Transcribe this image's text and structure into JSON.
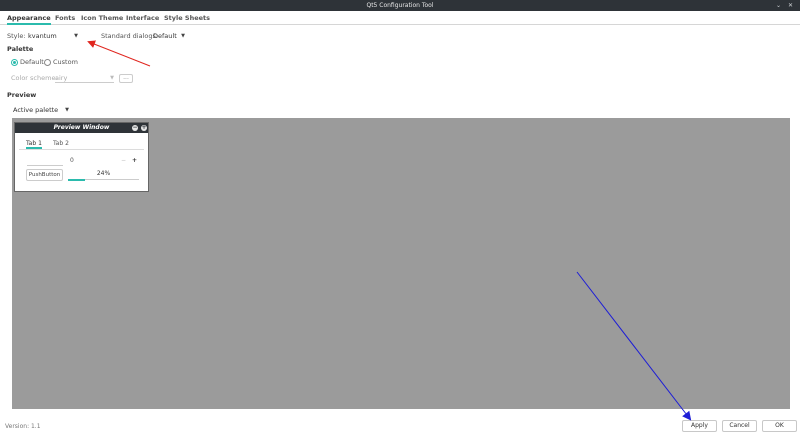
{
  "window": {
    "title": "Qt5 Configuration Tool",
    "controls": [
      "chevron-down-icon",
      "close-icon"
    ]
  },
  "tabs": [
    {
      "label": "Appearance",
      "active": true
    },
    {
      "label": "Fonts",
      "active": false
    },
    {
      "label": "Icon Theme",
      "active": false
    },
    {
      "label": "Interface",
      "active": false
    },
    {
      "label": "Style Sheets",
      "active": false
    }
  ],
  "style": {
    "label": "Style:",
    "value": "kvantum"
  },
  "dialogs": {
    "label": "Standard dialogs:",
    "value": "Default"
  },
  "palette": {
    "title": "Palette",
    "options": [
      {
        "label": "Default",
        "checked": true
      },
      {
        "label": "Custom",
        "checked": false
      }
    ],
    "scheme_label": "Color scheme:",
    "scheme_value": "airy",
    "more_button": "..."
  },
  "preview": {
    "title": "Preview",
    "palette_select": "Active palette",
    "background_color": "#9b9b9b",
    "window": {
      "title": "Preview Window",
      "tabs": [
        "Tab 1",
        "Tab 2"
      ],
      "spin_value": "0",
      "spin_minus": "−",
      "spin_plus": "+",
      "push_button": "PushButton",
      "progress_text": "24%",
      "progress_fraction": 0.24
    }
  },
  "footer": {
    "version": "Version: 1.1",
    "apply": "Apply",
    "cancel": "Cancel",
    "ok": "OK"
  },
  "colors": {
    "accent": "#2bbbad",
    "titlebar": "#2e3338",
    "annotation_red": "#e0261f",
    "annotation_blue": "#1d1dd6"
  }
}
